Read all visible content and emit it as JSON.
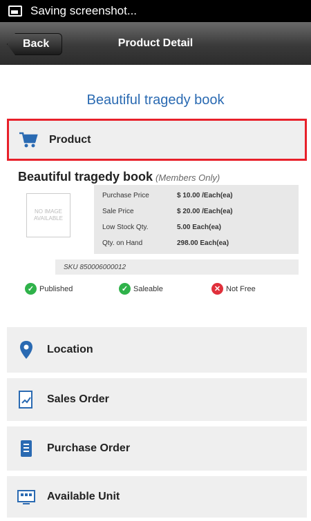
{
  "status_bar": {
    "text": "Saving screenshot..."
  },
  "header": {
    "back_label": "Back",
    "title": "Product Detail"
  },
  "page_title": "Beautiful tragedy book",
  "sections": {
    "product": "Product",
    "location": "Location",
    "sales_order": "Sales Order",
    "purchase_order": "Purchase Order",
    "available_unit": "Available Unit"
  },
  "product": {
    "name": "Beautiful tragedy book",
    "members_only": "(Members Only)",
    "no_image_text": "NO IMAGE AVAILABLE",
    "details": [
      {
        "label": "Purchase Price",
        "value": "$  10.00 /Each(ea)"
      },
      {
        "label": "Sale Price",
        "value": "$  20.00 /Each(ea)"
      },
      {
        "label": "Low Stock Qty.",
        "value": "5.00  Each(ea)"
      },
      {
        "label": "Qty. on Hand",
        "value": "298.00  Each(ea)"
      }
    ],
    "sku": "SKU 850006000012",
    "badges": {
      "published": "Published",
      "saleable": "Saleable",
      "not_free": "Not Free"
    }
  },
  "colors": {
    "accent": "#2a6ab2",
    "selected_border": "#e8202a",
    "check_green": "#2fb24a",
    "cross_red": "#e0303b"
  }
}
